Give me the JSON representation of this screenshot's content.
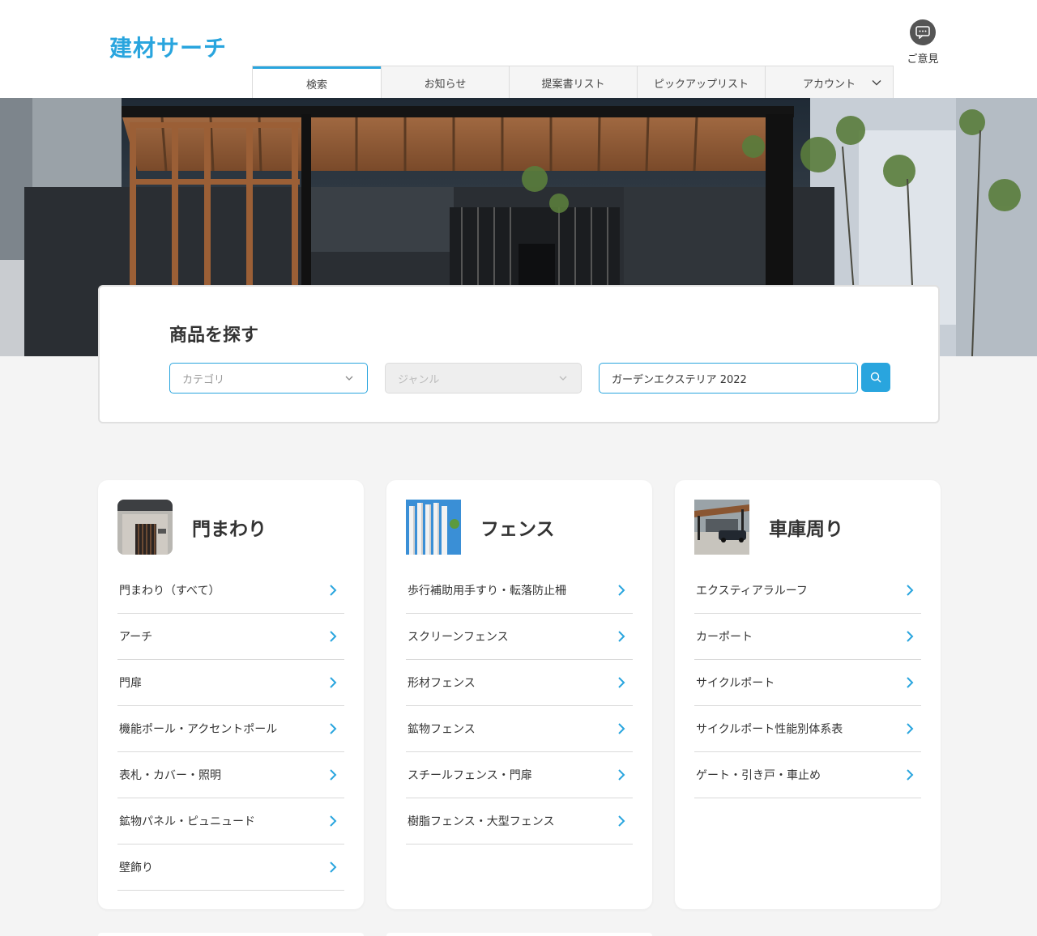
{
  "header": {
    "logo": "建材サーチ",
    "nav": [
      {
        "label": "検索",
        "active": true
      },
      {
        "label": "お知らせ",
        "active": false
      },
      {
        "label": "提案書リスト",
        "active": false
      },
      {
        "label": "ピックアップリスト",
        "active": false
      },
      {
        "label": "アカウント",
        "active": false,
        "has_dropdown": true
      }
    ],
    "feedback_label": "ご意見"
  },
  "search": {
    "title": "商品を探す",
    "category_placeholder": "カテゴリ",
    "genre_placeholder": "ジャンル",
    "keyword_value": "ガーデンエクステリア 2022"
  },
  "categories": [
    {
      "title": "門まわり",
      "items": [
        "門まわり（すべて）",
        "アーチ",
        "門扉",
        "機能ポール・アクセントポール",
        "表札・カバー・照明",
        "鉱物パネル・ピュニュード",
        "壁飾り"
      ]
    },
    {
      "title": "フェンス",
      "items": [
        "歩行補助用手すり・転落防止柵",
        "スクリーンフェンス",
        "形材フェンス",
        "鉱物フェンス",
        "スチールフェンス・門扉",
        "樹脂フェンス・大型フェンス"
      ]
    },
    {
      "title": "車庫周り",
      "items": [
        "エクスティアラルーフ",
        "カーポート",
        "サイクルポート",
        "サイクルポート性能別体系表",
        "ゲート・引き戸・車止め"
      ]
    }
  ],
  "colors": {
    "accent": "#29a5de",
    "background": "#f4f4f4"
  }
}
